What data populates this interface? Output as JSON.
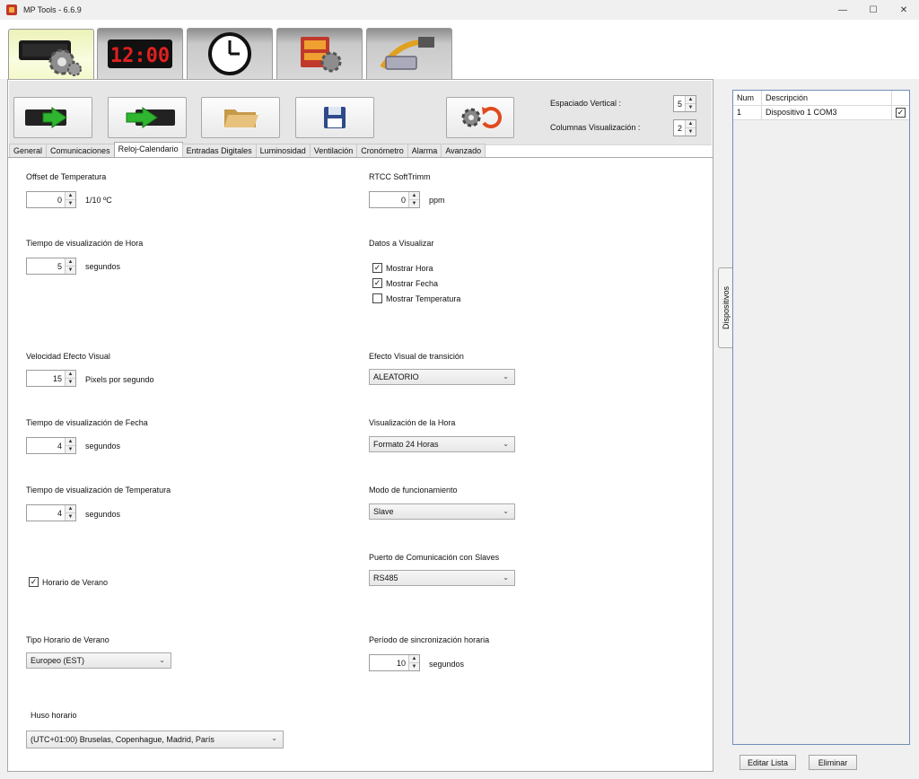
{
  "window": {
    "title": "MP Tools - 6.6.9",
    "minimize": "—",
    "maximize": "☐",
    "close": "✕"
  },
  "top_tabs": [
    {
      "name": "tab-display-settings",
      "icon": "gear-board-icon",
      "active": true
    },
    {
      "name": "tab-clock-display",
      "icon": "led-clock-icon",
      "display_text": "12:00"
    },
    {
      "name": "tab-time",
      "icon": "wall-clock-icon"
    },
    {
      "name": "tab-mp-tools",
      "icon": "mp-tools-logo-icon"
    },
    {
      "name": "tab-connection",
      "icon": "serial-cable-icon"
    }
  ],
  "toolbar": {
    "vertical_spacing_label": "Espaciado Vertical :",
    "vertical_spacing_value": "5",
    "display_columns_label": "Columnas Visualización :",
    "display_columns_value": "2"
  },
  "tabs": [
    "General",
    "Comunicaciones",
    "Reloj-Calendario",
    "Entradas Digitales",
    "Luminosidad",
    "Ventilación",
    "Cronómetro",
    "Alarma",
    "Avanzado"
  ],
  "active_tab": "Reloj-Calendario",
  "left": {
    "temp_offset_label": "Offset de Temperatura",
    "temp_offset_value": "0",
    "temp_offset_unit": "1/10 ºC",
    "hour_time_label": "Tiempo de visualización de Hora",
    "hour_time_value": "5",
    "hour_time_unit": "segundos",
    "effect_speed_label": "Velocidad Efecto Visual",
    "effect_speed_value": "15",
    "effect_speed_unit": "Pixels por segundo",
    "date_time_label": "Tiempo de visualización de Fecha",
    "date_time_value": "4",
    "date_time_unit": "segundos",
    "temp_time_label": "Tiempo de visualización de Temperatura",
    "temp_time_value": "4",
    "temp_time_unit": "segundos",
    "dst_label": "Horario de Verano",
    "dst_type_label": "Tipo Horario de Verano",
    "dst_type_value": "Europeo (EST)",
    "timezone_label": "Huso horario",
    "timezone_value": "(UTC+01:00) Bruselas, Copenhague, Madrid, París"
  },
  "right": {
    "rtcc_label": "RTCC SoftTrimm",
    "rtcc_value": "0",
    "rtcc_unit": "ppm",
    "data_label": "Datos a Visualizar",
    "show_hour": "Mostrar Hora",
    "show_date": "Mostrar Fecha",
    "show_temp": "Mostrar Temperatura",
    "transition_label": "Efecto Visual de transición",
    "transition_value": "ALEATORIO",
    "hour_format_label": "Visualización de la Hora",
    "hour_format_value": "Formato 24 Horas",
    "mode_label": "Modo de funcionamiento",
    "mode_value": "Slave",
    "slave_port_label": "Puerto de Comunicación con Slaves",
    "slave_port_value": "RS485",
    "sync_label": "Período de sincronización horaria",
    "sync_value": "10",
    "sync_unit": "segundos"
  },
  "side_tab": "Dispositivos",
  "devices": {
    "col_num": "Num",
    "col_desc": "Descripción",
    "rows": [
      {
        "num": "1",
        "desc": "Dispositivo 1 COM3"
      }
    ]
  },
  "buttons": {
    "edit_list": "Editar Lista",
    "delete": "Eliminar"
  },
  "checks": {
    "dst": true,
    "show_hour": true,
    "show_date": true,
    "show_temp": false,
    "device1": true
  },
  "check_mark": "✓",
  "arrow_up": "▲",
  "arrow_down": "▼",
  "chevron": "⌄"
}
